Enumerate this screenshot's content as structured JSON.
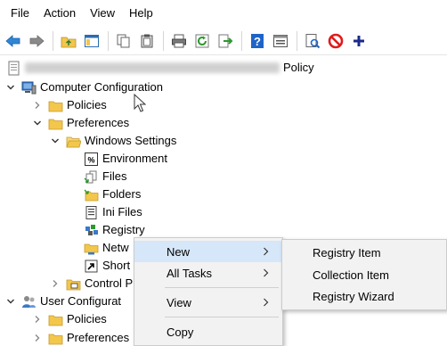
{
  "menubar": {
    "items": [
      {
        "id": "file",
        "label": "File"
      },
      {
        "id": "action",
        "label": "Action"
      },
      {
        "id": "view",
        "label": "View"
      },
      {
        "id": "help",
        "label": "Help"
      }
    ]
  },
  "toolbar": {
    "icons": [
      "back-arrow-icon",
      "forward-arrow-icon",
      "up-folder-icon",
      "show-hide-tree-icon",
      "copy-icon",
      "paste-icon",
      "print-icon",
      "refresh-icon",
      "export-list-icon",
      "help-icon",
      "properties-pane-icon",
      "document-search-icon",
      "block-icon",
      "add-icon"
    ]
  },
  "tree": {
    "root_suffix": "Policy",
    "computer_config": "Computer Configuration",
    "policies": "Policies",
    "preferences": "Preferences",
    "windows_settings": "Windows Settings",
    "environment": "Environment",
    "files": "Files",
    "folders": "Folders",
    "ini_files": "Ini Files",
    "registry": "Registry",
    "network_shares_partial": "Netw",
    "shortcuts_partial": "Short",
    "control_panel_partial": "Control P",
    "user_config_partial": "User Configurat",
    "user_policies": "Policies",
    "user_preferences": "Preferences"
  },
  "context_menu": {
    "items": [
      {
        "id": "new",
        "label": "New",
        "has_submenu": true,
        "highlighted": true
      },
      {
        "id": "all_tasks",
        "label": "All Tasks",
        "has_submenu": true
      },
      {
        "id": "view",
        "label": "View",
        "has_submenu": true
      },
      {
        "id": "copy",
        "label": "Copy",
        "has_submenu": false
      }
    ]
  },
  "submenu": {
    "items": [
      {
        "id": "registry_item",
        "label": "Registry Item"
      },
      {
        "id": "collection_item",
        "label": "Collection Item"
      },
      {
        "id": "registry_wizard",
        "label": "Registry Wizard"
      }
    ]
  },
  "colors": {
    "folder": "#f3c64c",
    "highlight": "#d5e7f9",
    "menu_bg": "#f2f2f2",
    "accent_blue": "#1e64c8"
  }
}
